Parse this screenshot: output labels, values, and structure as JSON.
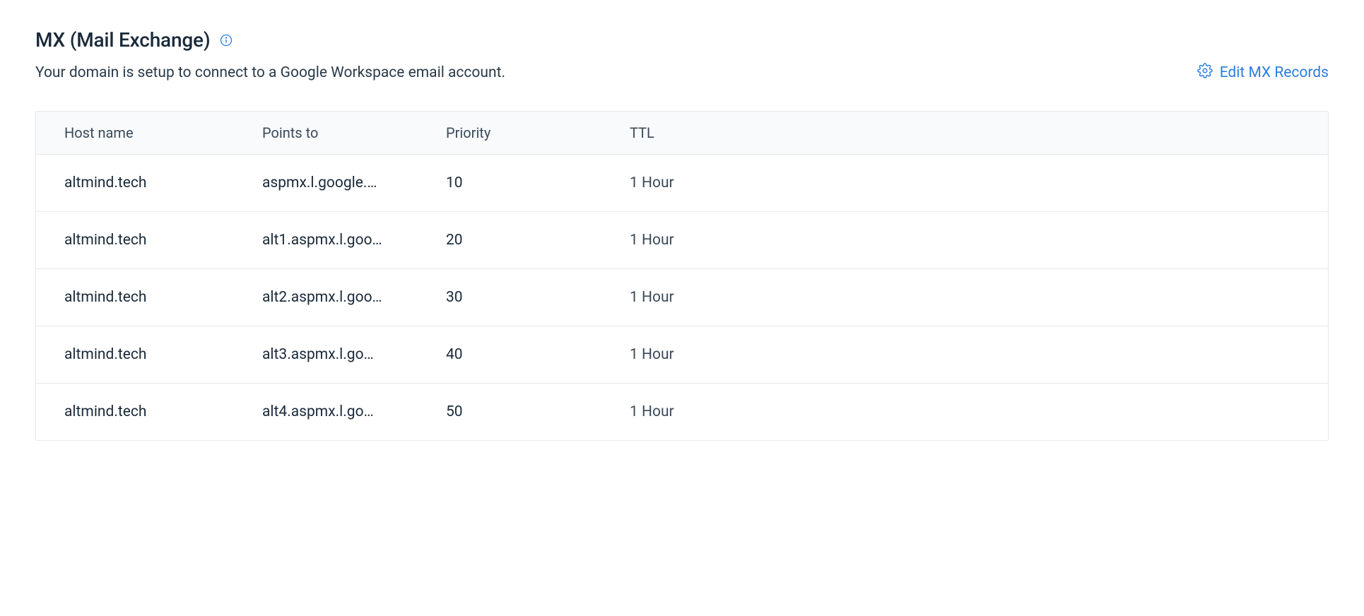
{
  "section": {
    "title": "MX (Mail Exchange)",
    "description": "Your domain is setup to connect to a Google Workspace email account.",
    "edit_label": "Edit MX Records"
  },
  "table": {
    "headers": {
      "host": "Host name",
      "points_to": "Points to",
      "priority": "Priority",
      "ttl": "TTL"
    },
    "rows": [
      {
        "host": "altmind.tech",
        "points_to": "aspmx.l.google.…",
        "priority": "10",
        "ttl": "1 Hour"
      },
      {
        "host": "altmind.tech",
        "points_to": "alt1.aspmx.l.goo…",
        "priority": "20",
        "ttl": "1 Hour"
      },
      {
        "host": "altmind.tech",
        "points_to": "alt2.aspmx.l.goo…",
        "priority": "30",
        "ttl": "1 Hour"
      },
      {
        "host": "altmind.tech",
        "points_to": "alt3.aspmx.l.go…",
        "priority": "40",
        "ttl": "1 Hour"
      },
      {
        "host": "altmind.tech",
        "points_to": "alt4.aspmx.l.go…",
        "priority": "50",
        "ttl": "1 Hour"
      }
    ]
  }
}
